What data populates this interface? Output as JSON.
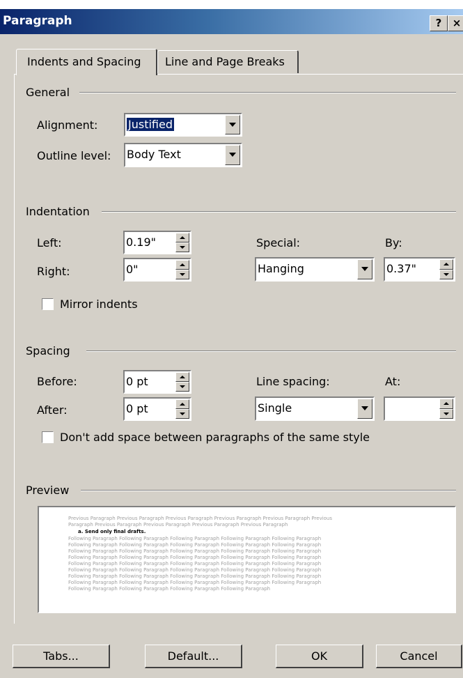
{
  "dialog": {
    "title": "Paragraph",
    "help_label": "?",
    "close_label": "×"
  },
  "tabs": [
    {
      "label": "Indents and Spacing"
    },
    {
      "label": "Line and Page Breaks"
    }
  ],
  "general": {
    "group_label": "General",
    "alignment_label": "Alignment:",
    "alignment_value": "Justified",
    "outline_label": "Outline level:",
    "outline_value": "Body Text"
  },
  "indentation": {
    "group_label": "Indentation",
    "left_label": "Left:",
    "left_value": "0.19\"",
    "right_label": "Right:",
    "right_value": "0\"",
    "special_label": "Special:",
    "special_value": "Hanging",
    "by_label": "By:",
    "by_value": "0.37\"",
    "mirror_label": "Mirror indents"
  },
  "spacing": {
    "group_label": "Spacing",
    "before_label": "Before:",
    "before_value": "0 pt",
    "after_label": "After:",
    "after_value": "0 pt",
    "line_spacing_label": "Line spacing:",
    "line_spacing_value": "Single",
    "at_label": "At:",
    "at_value": "",
    "dont_add_label": "Don't add space between paragraphs of the same style"
  },
  "preview": {
    "group_label": "Preview",
    "previous_lines": [
      "Previous Paragraph Previous Paragraph Previous Paragraph Previous Paragraph Previous Paragraph Previous",
      "Paragraph Previous Paragraph Previous Paragraph Previous Paragraph Previous Paragraph"
    ],
    "current_line": "a.     Send only final drafts.",
    "following_lines": [
      "Following Paragraph Following Paragraph Following Paragraph Following Paragraph Following Paragraph",
      "Following Paragraph Following Paragraph Following Paragraph Following Paragraph Following Paragraph",
      "Following Paragraph Following Paragraph Following Paragraph Following Paragraph Following Paragraph",
      "Following Paragraph Following Paragraph Following Paragraph Following Paragraph Following Paragraph",
      "Following Paragraph Following Paragraph Following Paragraph Following Paragraph Following Paragraph",
      "Following Paragraph Following Paragraph Following Paragraph Following Paragraph Following Paragraph",
      "Following Paragraph Following Paragraph Following Paragraph Following Paragraph Following Paragraph",
      "Following Paragraph Following Paragraph Following Paragraph Following Paragraph Following Paragraph",
      "Following Paragraph Following Paragraph Following Paragraph Following Paragraph"
    ]
  },
  "buttons": {
    "tabs": "Tabs...",
    "default": "Default...",
    "ok": "OK",
    "cancel": "Cancel"
  },
  "colors": {
    "dialog_bg": "#d4d0c8",
    "title_start": "#0a246a",
    "title_end": "#a6caf0",
    "selection": "#0a246a"
  }
}
